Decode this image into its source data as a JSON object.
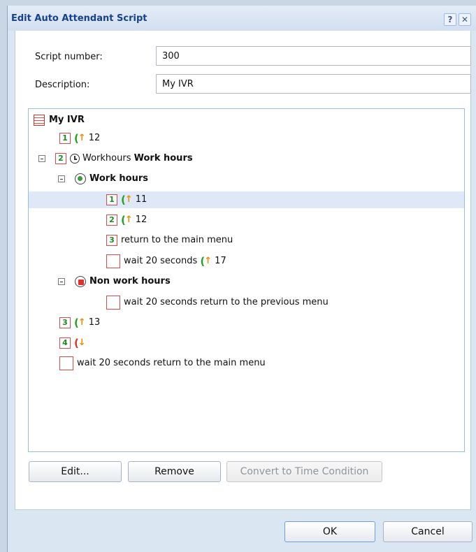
{
  "dialog": {
    "title": "Edit Auto Attendant Script",
    "help_label": "?",
    "close_label": "✕"
  },
  "form": {
    "script_number_label": "Script number:",
    "script_number_value": "300",
    "description_label": "Description:",
    "description_value": "My IVR"
  },
  "tree": {
    "root": "My IVR",
    "n1_num": "1",
    "n1_text": "12",
    "n2_num": "2",
    "n2_text": "Workhours",
    "n2_bold": "Work hours",
    "wh_label": "Work hours",
    "wh1_num": "1",
    "wh1_text": "11",
    "wh2_num": "2",
    "wh2_text": "12",
    "wh3_num": "3",
    "wh3_text": "return to the main menu",
    "wh4_text": "wait 20 seconds",
    "wh4_num": "17",
    "nwh_label": "Non work hours",
    "nwh1_text": "wait 20 seconds return to the previous menu",
    "n3_num": "3",
    "n3_text": "13",
    "n4_num": "4",
    "n5_text": "wait 20 seconds return to the main menu"
  },
  "buttons": {
    "edit": "Edit...",
    "remove": "Remove",
    "convert": "Convert to Time Condition",
    "ok": "OK",
    "cancel": "Cancel"
  },
  "colors": {
    "title": "#15428b",
    "selection": "#dfe8f6",
    "number_border": "#e34848",
    "number_text": "#1f8a1f"
  }
}
